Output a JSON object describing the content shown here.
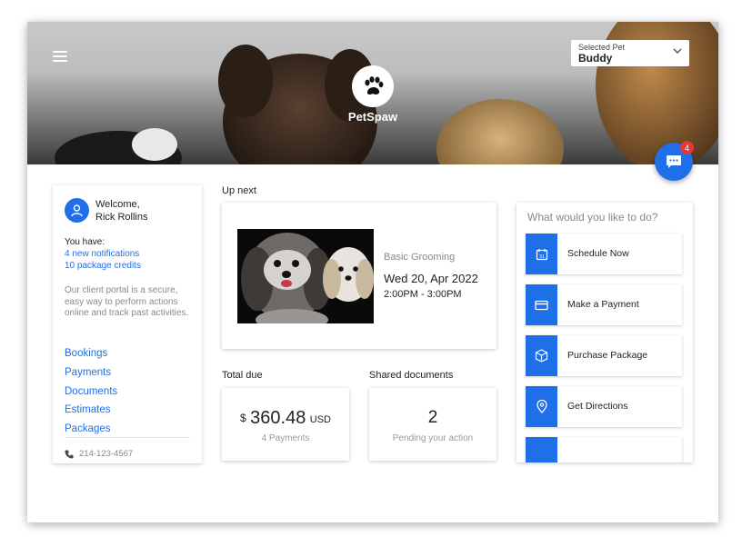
{
  "app": {
    "brand": "PetSpaw"
  },
  "header": {
    "pet_selector": {
      "label": "Selected Pet",
      "value": "Buddy"
    },
    "chat_badge": "4"
  },
  "welcome": {
    "greeting": "Welcome,",
    "name": "Rick Rollins",
    "you_have": "You have:",
    "notifications": "4 new notifications",
    "credits": "10 package credits",
    "description": "Our client portal is a secure, easy way to perform actions online and track past activities.",
    "nav": [
      "Bookings",
      "Payments",
      "Documents",
      "Estimates",
      "Packages"
    ],
    "phone": "214-123-4567"
  },
  "up_next": {
    "title": "Up next",
    "service": "Basic Grooming",
    "date": "Wed 20, Apr 2022",
    "time": "2:00PM - 3:00PM"
  },
  "total_due": {
    "title": "Total due",
    "currency_symbol": "$",
    "amount": "360.48",
    "currency_code": "USD",
    "sub": "4 Payments"
  },
  "shared_docs": {
    "title": "Shared documents",
    "count": "2",
    "sub": "Pending your action"
  },
  "actions": {
    "title": "What would you like to do?",
    "items": [
      {
        "label": "Schedule Now",
        "icon": "calendar-icon"
      },
      {
        "label": "Make a Payment",
        "icon": "credit-card-icon"
      },
      {
        "label": "Purchase Package",
        "icon": "package-box-icon"
      },
      {
        "label": "Get Directions",
        "icon": "location-pin-icon"
      }
    ]
  },
  "colors": {
    "accent": "#1f6fea",
    "badge": "#e53935"
  }
}
